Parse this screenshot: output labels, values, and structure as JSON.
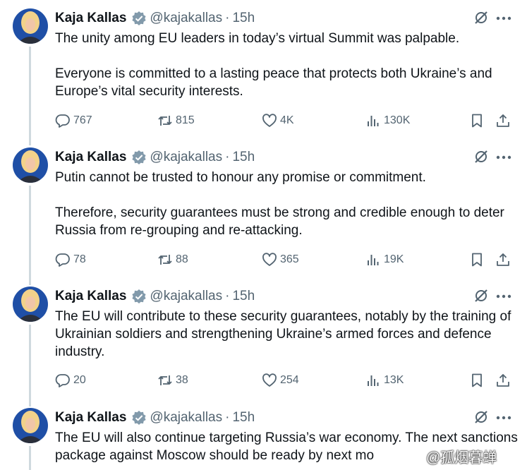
{
  "author": {
    "name": "Kaja Kallas",
    "handle": "@kajakallas",
    "separator": "·"
  },
  "colors": {
    "text": "#0f1419",
    "secondary": "#536471",
    "verified_badge": "#829aab",
    "thread_line": "#cfd9de"
  },
  "icons": [
    "verified-badge-icon",
    "grok-icon",
    "more-icon",
    "reply-icon",
    "retweet-icon",
    "like-icon",
    "views-icon",
    "bookmark-icon",
    "share-icon"
  ],
  "tweets": [
    {
      "time": "15h",
      "paragraphs": [
        "The unity among EU leaders in today’s virtual Summit was palpable.",
        "Everyone is committed to a lasting peace that protects both Ukraine’s and Europe’s vital security interests."
      ],
      "replies": "767",
      "retweets": "815",
      "likes": "4K",
      "views": "130K"
    },
    {
      "time": "15h",
      "paragraphs": [
        "Putin cannot be trusted to honour any promise or commitment.",
        "Therefore, security guarantees must be strong and credible enough to deter Russia from re-grouping and re-attacking."
      ],
      "replies": "78",
      "retweets": "88",
      "likes": "365",
      "views": "19K"
    },
    {
      "time": "15h",
      "paragraphs": [
        "The EU will contribute to these security guarantees, notably by the training of Ukrainian soldiers and strengthening Ukraine’s armed forces and defence industry."
      ],
      "replies": "20",
      "retweets": "38",
      "likes": "254",
      "views": "13K"
    },
    {
      "time": "15h",
      "paragraphs": [
        "The EU will also continue targeting Russia’s war economy. The next sanctions package against Moscow should be ready by next mo"
      ]
    }
  ],
  "watermark": "@孤烟暮蝉"
}
